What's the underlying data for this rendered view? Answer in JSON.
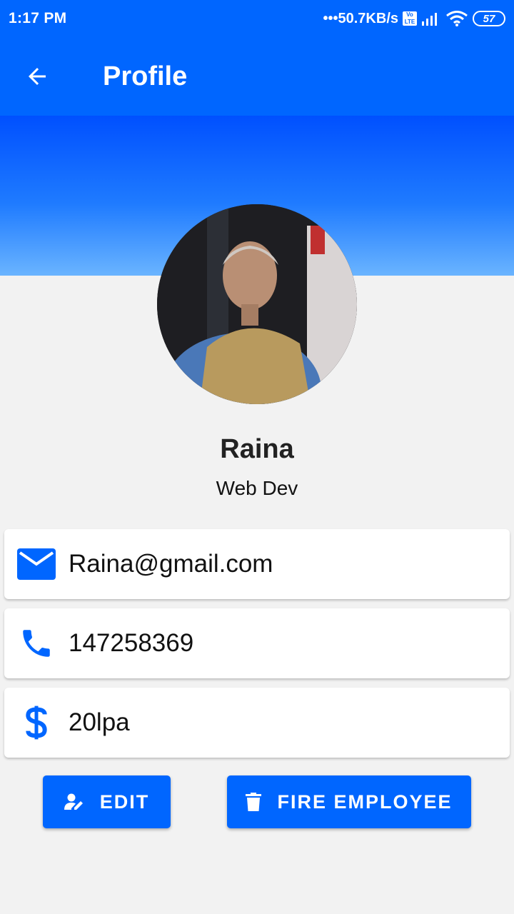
{
  "status_bar": {
    "time": "1:17 PM",
    "network_speed": "•••50.7KB/s",
    "volte": "Vo LTE",
    "battery": "57"
  },
  "app_bar": {
    "title": "Profile",
    "back_icon": "arrow-back-icon"
  },
  "profile": {
    "name": "Raina",
    "role": "Web Dev",
    "email": "Raina@gmail.com",
    "phone": "147258369",
    "salary": "20lpa"
  },
  "actions": {
    "edit_label": "EDIT",
    "fire_label": "FIRE EMPLOYEE"
  },
  "colors": {
    "primary": "#0066ff",
    "background": "#f2f2f2",
    "card": "#ffffff"
  },
  "icons": {
    "email": "email-icon",
    "phone": "phone-icon",
    "salary": "dollar-icon",
    "edit": "person-edit-icon",
    "fire": "trash-icon"
  }
}
